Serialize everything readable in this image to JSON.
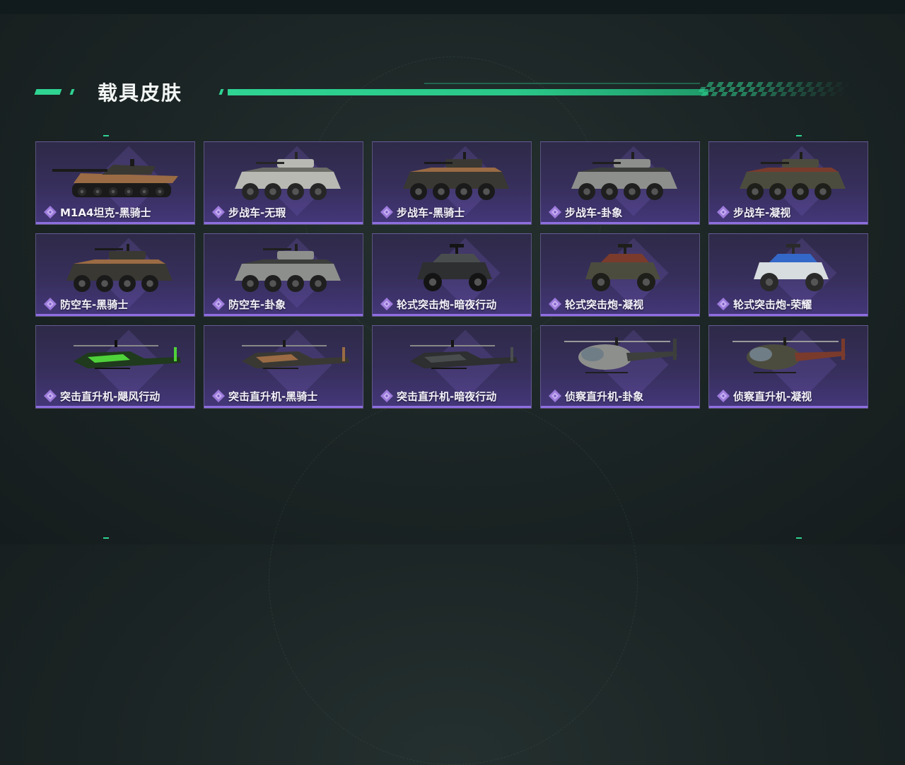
{
  "header": {
    "title": "载具皮肤"
  },
  "colors": {
    "accent": "#2fd392",
    "card_purple": "#44377a",
    "gem": "#9d7bdc"
  },
  "skins": [
    {
      "name": "M1A4坦克-黑骑士",
      "kind": "tank",
      "palette": "blackknight"
    },
    {
      "name": "步战车-无瑕",
      "kind": "ifv",
      "palette": "flawless"
    },
    {
      "name": "步战车-黑骑士",
      "kind": "ifv",
      "palette": "blackknight"
    },
    {
      "name": "步战车-卦象",
      "kind": "ifv",
      "palette": "hexagram"
    },
    {
      "name": "步战车-凝视",
      "kind": "ifv",
      "palette": "gaze"
    },
    {
      "name": "防空车-黑骑士",
      "kind": "aa",
      "palette": "blackknight"
    },
    {
      "name": "防空车-卦象",
      "kind": "aa",
      "palette": "hexagram"
    },
    {
      "name": "轮式突击炮-暗夜行动",
      "kind": "buggy",
      "palette": "night"
    },
    {
      "name": "轮式突击炮-凝视",
      "kind": "buggy",
      "palette": "gaze"
    },
    {
      "name": "轮式突击炮-荣耀",
      "kind": "buggy",
      "palette": "glory"
    },
    {
      "name": "突击直升机-飓风行动",
      "kind": "attackheli",
      "palette": "hurricane"
    },
    {
      "name": "突击直升机-黑骑士",
      "kind": "attackheli",
      "palette": "blackknight"
    },
    {
      "name": "突击直升机-暗夜行动",
      "kind": "attackheli",
      "palette": "night"
    },
    {
      "name": "侦察直升机-卦象",
      "kind": "scoutheli",
      "palette": "hexagram"
    },
    {
      "name": "侦察直升机-凝视",
      "kind": "scoutheli",
      "palette": "gaze"
    }
  ]
}
